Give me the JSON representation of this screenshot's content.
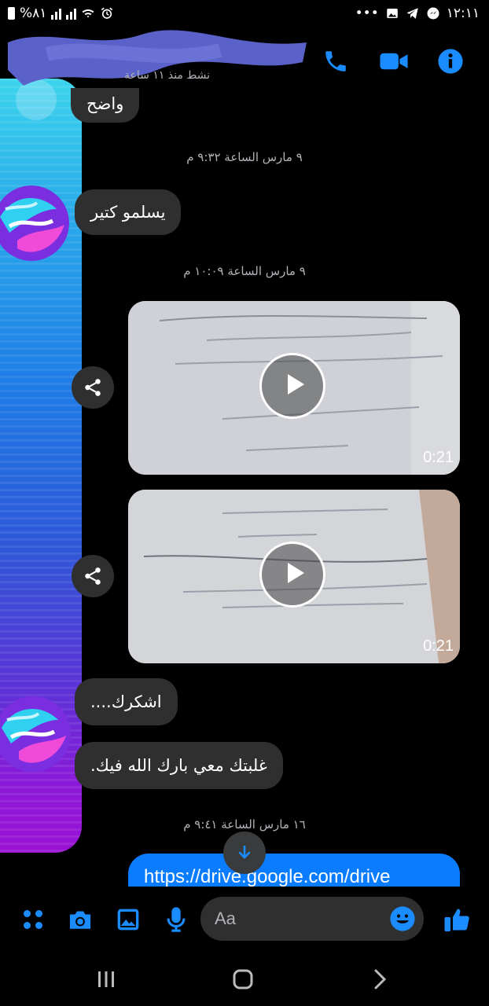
{
  "status_bar": {
    "battery_text": "%٨١",
    "time": "١٢:١١",
    "more": "•••"
  },
  "header": {
    "active_status": "نشط منذ ١١ ساعة",
    "icons": [
      "phone-icon",
      "video-camera-icon",
      "info-icon"
    ]
  },
  "messages": {
    "partial_top": "واضح",
    "ts1": "٩ مارس الساعة ٩:٣٢ م",
    "m1": "يسلمو كتير",
    "ts2": "٩ مارس الساعة ١٠:٠٩ م",
    "video1_duration": "0:21",
    "video2_duration": "0:21",
    "m2": "اشكرك....",
    "m3": "غلبتك معي بارك الله فيك.",
    "ts3": "١٦ مارس الساعة ٩:٤١ م",
    "link": "https://drive.google.com/drive"
  },
  "composer": {
    "placeholder": "Aa",
    "icons": [
      "apps-icon",
      "camera-icon",
      "gallery-icon",
      "microphone-icon",
      "emoji-icon",
      "thumbs-up-icon"
    ]
  },
  "navbar": {
    "icons": [
      "recent-apps-icon",
      "home-icon",
      "back-icon"
    ]
  },
  "colors": {
    "accent": "#0a7cff",
    "bubble_incoming": "#2f2f2f",
    "background": "#000000"
  }
}
